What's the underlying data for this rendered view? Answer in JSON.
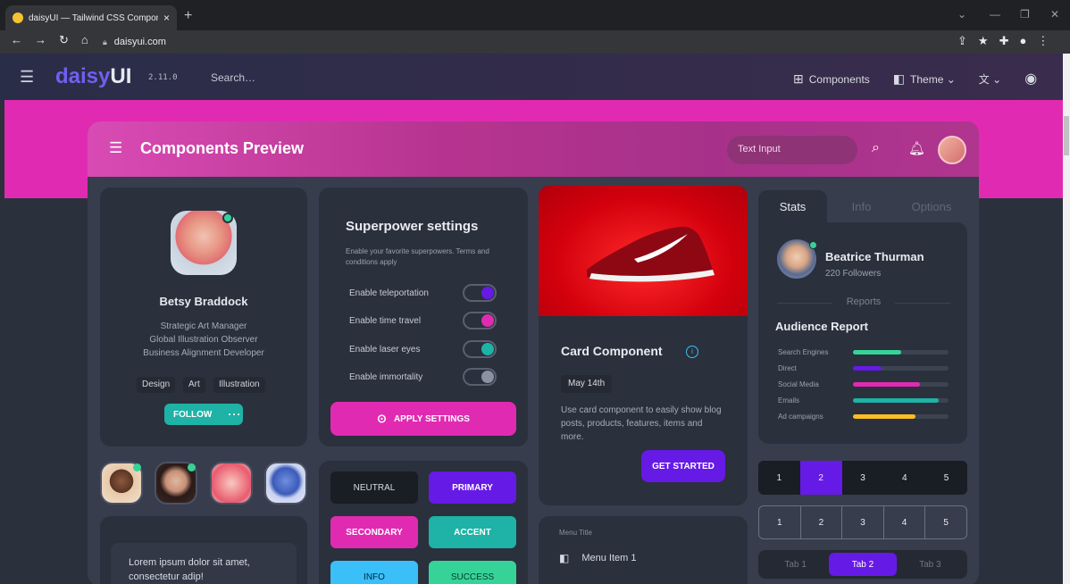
{
  "browser": {
    "tab_title": "daisyUI — Tailwind CSS Compon…",
    "url": "daisyui.com",
    "new_tab": "+",
    "close": "×"
  },
  "navbar": {
    "logo_a": "daisy",
    "logo_b": "UI",
    "version": "2.11.0",
    "search_placeholder": "Search…",
    "components": "Components",
    "theme": "Theme"
  },
  "preview": {
    "title": "Components Preview",
    "text_input_placeholder": "Text Input"
  },
  "profile": {
    "name": "Betsy Braddock",
    "roles": [
      "Strategic Art Manager",
      "Global Illustration Observer",
      "Business Alignment Developer"
    ],
    "tags": [
      "Design",
      "Art",
      "Illustration"
    ],
    "follow": "FOLLOW",
    "more": "···"
  },
  "lorem": {
    "text": "Lorem ipsum dolor sit amet, consectetur adip!"
  },
  "superpower": {
    "title": "Superpower settings",
    "desc": "Enable your favorite superpowers. Terms and conditions apply",
    "toggles": [
      {
        "label": "Enable teleportation",
        "on": true,
        "color": "#661ae6"
      },
      {
        "label": "Enable time travel",
        "on": true,
        "color": "#e12ab2"
      },
      {
        "label": "Enable laser eyes",
        "on": true,
        "color": "#1fb2a6"
      },
      {
        "label": "Enable immortality",
        "on": false,
        "color": "#8a91a0"
      }
    ],
    "apply": "APPLY SETTINGS"
  },
  "buttons": [
    {
      "label": "NEUTRAL",
      "bg": "#191d24",
      "fg": "#d7dbe3"
    },
    {
      "label": "PRIMARY",
      "bg": "#661ae6",
      "fg": "#ffffff"
    },
    {
      "label": "SECONDARY",
      "bg": "#e12ab2",
      "fg": "#ffffff"
    },
    {
      "label": "ACCENT",
      "bg": "#1fb2a6",
      "fg": "#ffffff"
    },
    {
      "label": "INFO",
      "bg": "#3abff8",
      "fg": "#06243a"
    },
    {
      "label": "SUCCESS",
      "bg": "#36d399",
      "fg": "#063d28"
    }
  ],
  "card": {
    "title": "Card Component",
    "date": "May 14th",
    "desc": "Use card component to easily show blog posts, products, features, items and more.",
    "cta": "GET STARTED"
  },
  "menu": {
    "title": "Menu Title",
    "item": "Menu Item 1"
  },
  "stats": {
    "tabs": [
      "Stats",
      "Info",
      "Options"
    ],
    "name": "Beatrice Thurman",
    "followers": "220 Followers",
    "reports": "Reports",
    "audience": "Audience Report",
    "bars": [
      {
        "label": "Search Engines",
        "value": 0.5,
        "color": "#36d399"
      },
      {
        "label": "Direct",
        "value": 0.3,
        "color": "#661ae6"
      },
      {
        "label": "Social Media",
        "value": 0.7,
        "color": "#e12ab2"
      },
      {
        "label": "Emails",
        "value": 0.9,
        "color": "#1fb2a6"
      },
      {
        "label": "Ad campaigns",
        "value": 0.65,
        "color": "#fbbd23"
      }
    ]
  },
  "pagination": {
    "pages": [
      "1",
      "2",
      "3",
      "4",
      "5"
    ],
    "active": "2"
  },
  "tabs_bottom": [
    "Tab 1",
    "Tab 2",
    "Tab 3"
  ]
}
